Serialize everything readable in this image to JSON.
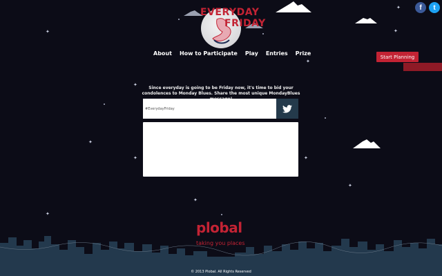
{
  "logo": {
    "line1": "EVERYDAY",
    "line2": "FRIDAY"
  },
  "social": {
    "facebook_glyph": "f",
    "twitter_glyph": "t"
  },
  "nav": {
    "items": [
      "About",
      "How to Participate",
      "Play",
      "Entries",
      "Prize"
    ]
  },
  "cta": {
    "label": "Start Planning"
  },
  "intro": {
    "text": "Since everyday is going to be Friday now, it's time to bid your condolences to Monday Blues. Share the most unique MondayBlues message!"
  },
  "form": {
    "hashtag_value": "#EverydayFriday",
    "message_value": ""
  },
  "footer": {
    "brand": "plobal",
    "tagline": "taking you places",
    "copyright": "© 2013 Plobal. All Rights Reserved"
  },
  "colors": {
    "background": "#0c0c17",
    "brand_red": "#c32334",
    "tweet_button": "#243a4b",
    "skyline": "#23394d"
  }
}
